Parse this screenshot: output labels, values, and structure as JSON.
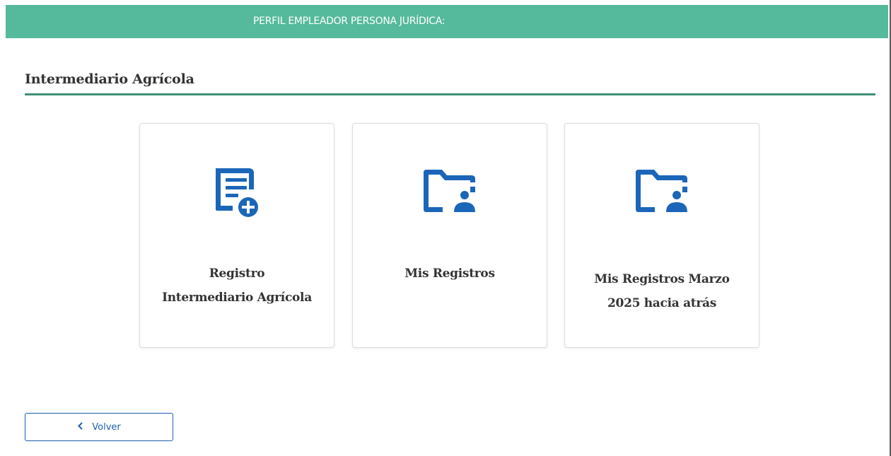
{
  "header": {
    "title": "PERFIL EMPLEADOR PERSONA JURÍDICA:"
  },
  "section": {
    "title": "Intermediario Agrícola"
  },
  "cards": [
    {
      "icon": "document-add-icon",
      "label_line1": "Registro",
      "label_line2": "Intermediario Agrícola"
    },
    {
      "icon": "folder-user-icon",
      "label_line1": "Mis Registros"
    },
    {
      "icon": "folder-user-icon",
      "label_line1": "Mis Registros Marzo",
      "label_line2": "2025 hacia atrás"
    }
  ],
  "back_button": {
    "label": "Volver",
    "icon": "chevron-left-icon"
  },
  "colors": {
    "header_bg": "#55b99b",
    "rule": "#3f8f77",
    "icon_blue": "#1b66b8",
    "button_blue": "#1f5fae",
    "title_text": "#333333"
  }
}
